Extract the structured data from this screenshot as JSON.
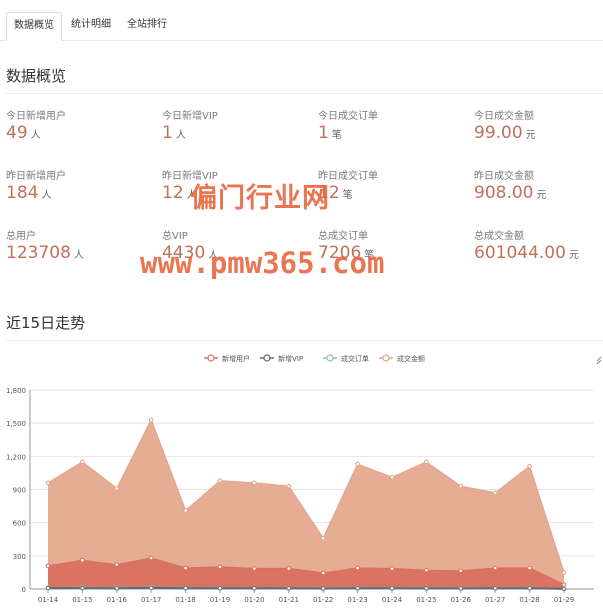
{
  "tabs": [
    "数据概览",
    "统计明细",
    "全站排行"
  ],
  "overview_title": "数据概览",
  "stats": [
    {
      "label": "今日新增用户",
      "value": "49",
      "unit": "人"
    },
    {
      "label": "今日新增VIP",
      "value": "1",
      "unit": "人"
    },
    {
      "label": "今日成交订单",
      "value": "1",
      "unit": "笔"
    },
    {
      "label": "今日成交金额",
      "value": "99.00",
      "unit": "元"
    },
    {
      "label": "昨日新增用户",
      "value": "184",
      "unit": "人"
    },
    {
      "label": "昨日新增VIP",
      "value": "12",
      "unit": "人"
    },
    {
      "label": "昨日成交订单",
      "value": "12",
      "unit": "笔"
    },
    {
      "label": "昨日成交金额",
      "value": "908.00",
      "unit": "元"
    },
    {
      "label": "总用户",
      "value": "123708",
      "unit": "人"
    },
    {
      "label": "总VIP",
      "value": "4430",
      "unit": "人"
    },
    {
      "label": "总成交订单",
      "value": "7206",
      "unit": "笔"
    },
    {
      "label": "总成交金额",
      "value": "601044.00",
      "unit": "元"
    }
  ],
  "watermark": {
    "line1": "偏门行业网",
    "line2": "www.pmw365.com"
  },
  "trend_title": "近15日走势",
  "colors": {
    "users": "#d9705f",
    "vip": "#5e6a73",
    "orders": "#8fc1b8",
    "amount": "#e3a48a"
  },
  "chart_data": {
    "type": "area",
    "categories": [
      "01-14",
      "01-15",
      "01-16",
      "01-17",
      "01-18",
      "01-19",
      "01-20",
      "01-21",
      "01-22",
      "01-23",
      "01-24",
      "01-25",
      "01-26",
      "01-27",
      "01-28",
      "01-29"
    ],
    "series": [
      {
        "name": "新增用户",
        "values": [
          210,
          260,
          220,
          280,
          190,
          200,
          185,
          185,
          145,
          190,
          185,
          170,
          165,
          190,
          190,
          40
        ]
      },
      {
        "name": "新增VIP",
        "values": [
          8,
          8,
          6,
          10,
          7,
          6,
          6,
          6,
          4,
          6,
          6,
          5,
          5,
          6,
          6,
          1
        ]
      },
      {
        "name": "成交订单",
        "values": [
          12,
          14,
          12,
          16,
          10,
          11,
          10,
          10,
          8,
          11,
          10,
          10,
          9,
          10,
          12,
          1
        ]
      },
      {
        "name": "成交金额",
        "values": [
          960,
          1150,
          910,
          1530,
          710,
          980,
          960,
          930,
          460,
          1130,
          1010,
          1150,
          930,
          870,
          1110,
          150
        ]
      }
    ],
    "yticks": [
      "0",
      "300",
      "600",
      "900",
      "1,200",
      "1,500",
      "1,800"
    ],
    "ylim": [
      0,
      1800
    ],
    "grid": true,
    "legend_position": "top-center"
  }
}
